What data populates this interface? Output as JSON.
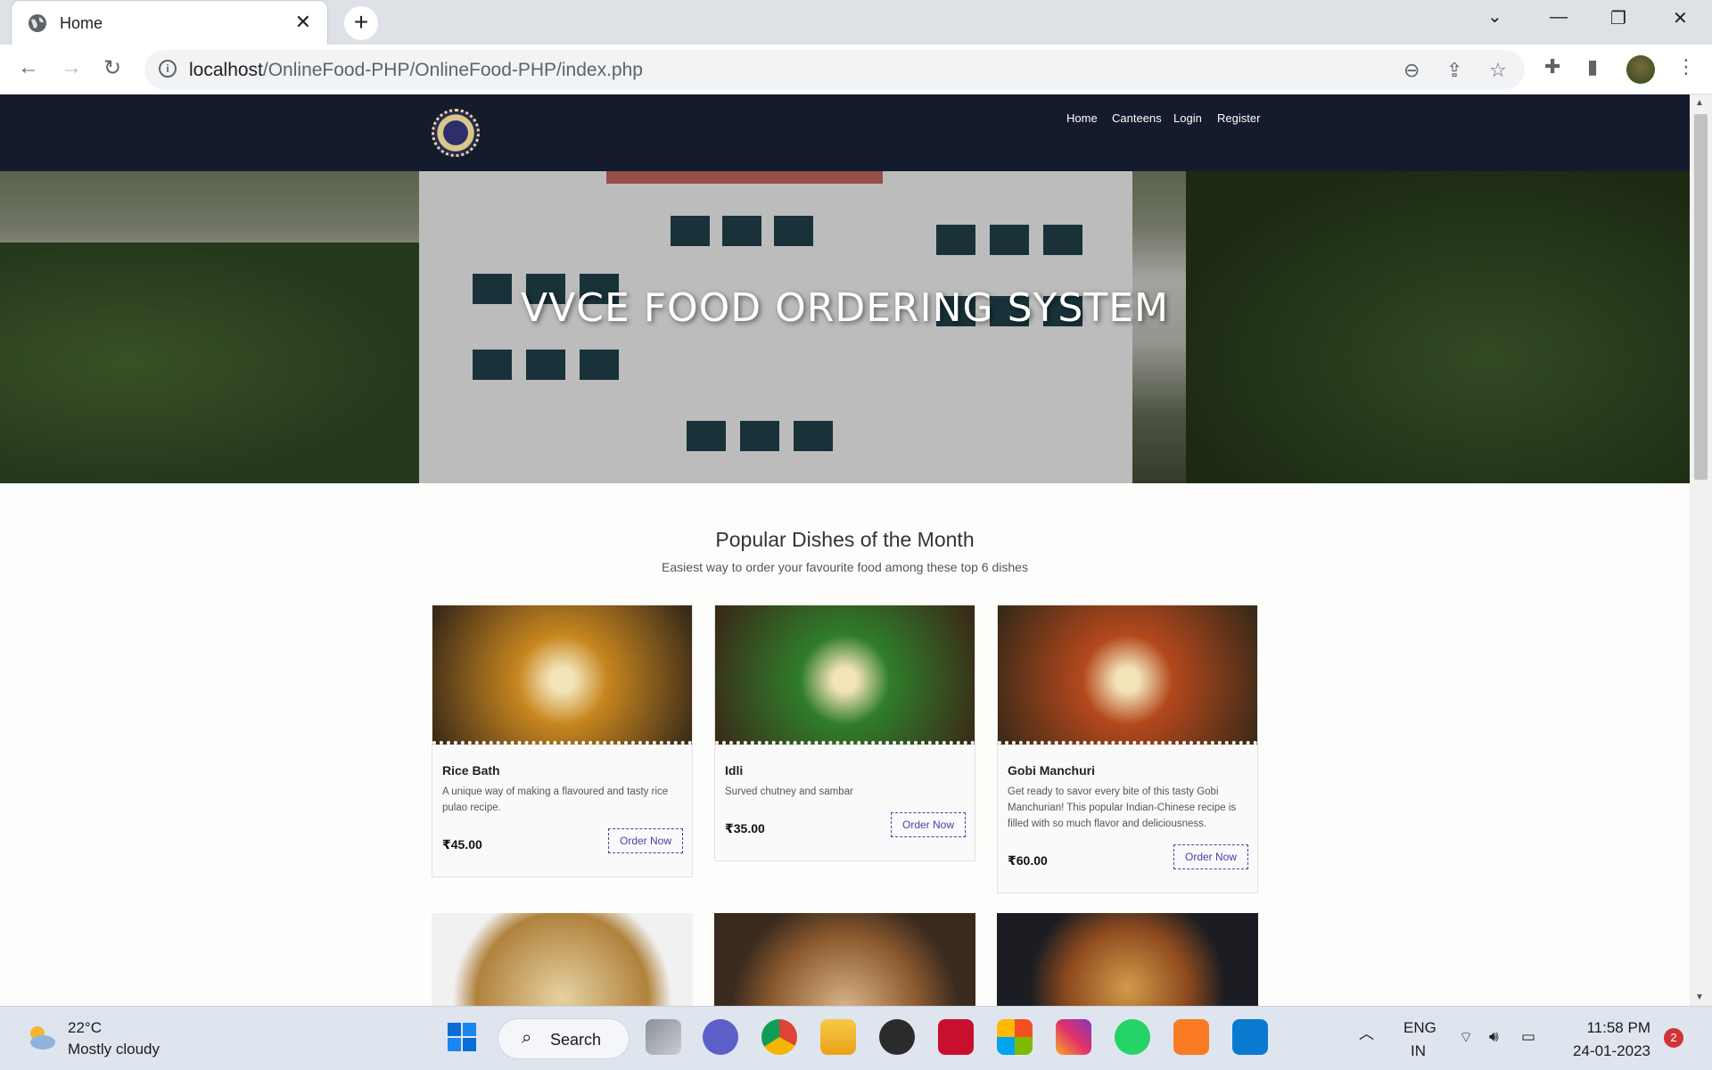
{
  "browser": {
    "tab_title": "Home",
    "tab_close": "✕",
    "new_tab": "+",
    "url_host": "localhost",
    "url_path": "/OnlineFood-PHP/OnlineFood-PHP/index.php"
  },
  "site": {
    "nav": [
      "Home",
      "Canteens",
      "Login",
      "Register"
    ],
    "hero_title": "VVCE FOOD ORDERING SYSTEM",
    "section_title": "Popular Dishes of the Month",
    "section_subtitle": "Easiest way to order your favourite food among these top 6 dishes",
    "order_label": "Order Now",
    "dishes": [
      {
        "name": "Rice Bath",
        "desc": "A unique way of making a flavoured and tasty rice pulao recipe.",
        "price": "₹45.00",
        "img_color": "#c7861f"
      },
      {
        "name": "Idli",
        "desc": "Surved chutney and sambar",
        "price": "₹35.00",
        "img_color": "#2f7d2a"
      },
      {
        "name": "Gobi Manchuri",
        "desc": "Get ready to savor every bite of this tasty Gobi Manchurian! This popular Indian-Chinese recipe is filled with so much flavor and deliciousness.",
        "price": "₹60.00",
        "img_color": "#b4481c"
      }
    ]
  },
  "taskbar": {
    "temperature": "22°C",
    "condition": "Mostly cloudy",
    "search_label": "Search",
    "language_top": "ENG",
    "language_bottom": "IN",
    "time": "11:58 PM",
    "date": "24-01-2023",
    "notifications": "2"
  }
}
